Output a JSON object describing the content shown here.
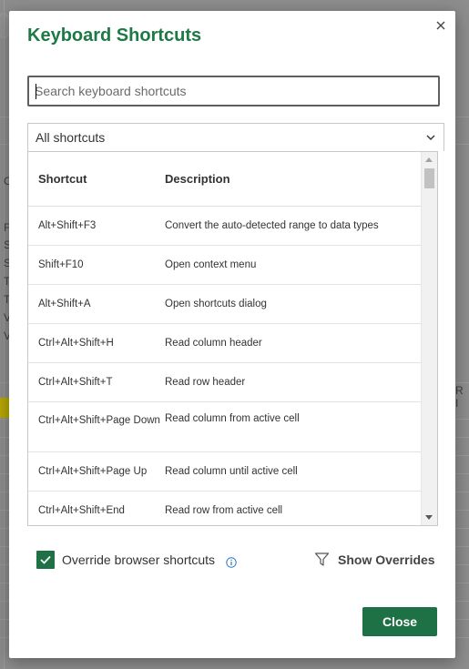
{
  "background": {
    "letters": [
      "C",
      "F",
      "S",
      "S",
      "T",
      "T",
      "V",
      "V",
      "R I"
    ]
  },
  "dialog": {
    "title": "Keyboard Shortcuts",
    "close_icon": "close-icon",
    "search": {
      "value": "",
      "placeholder": "Search keyboard shortcuts"
    },
    "filter": {
      "selected": "All shortcuts",
      "icon": "chevron-down-icon"
    },
    "table": {
      "headers": [
        "Shortcut",
        "Description"
      ],
      "rows": [
        {
          "shortcut": "Alt+Shift+F3",
          "description": "Convert the auto-detected range to data types"
        },
        {
          "shortcut": "Shift+F10",
          "description": "Open context menu"
        },
        {
          "shortcut": "Alt+Shift+A",
          "description": "Open shortcuts dialog"
        },
        {
          "shortcut": "Ctrl+Alt+Shift+H",
          "description": "Read column header"
        },
        {
          "shortcut": "Ctrl+Alt+Shift+T",
          "description": "Read row header"
        },
        {
          "shortcut": "Ctrl+Alt+Shift+Page Down",
          "description": "Read column from active cell"
        },
        {
          "shortcut": "Ctrl+Alt+Shift+Page Up",
          "description": "Read column until active cell"
        },
        {
          "shortcut": "Ctrl+Alt+Shift+End",
          "description": "Read row from active cell"
        }
      ]
    },
    "override": {
      "label": "Override browser shortcuts",
      "checked": true,
      "info_icon": "info-icon"
    },
    "show_overrides": {
      "label": "Show Overrides",
      "icon": "filter-icon"
    },
    "close_button": "Close"
  },
  "colors": {
    "accent": "#1e7145",
    "title": "#1e7a45"
  }
}
